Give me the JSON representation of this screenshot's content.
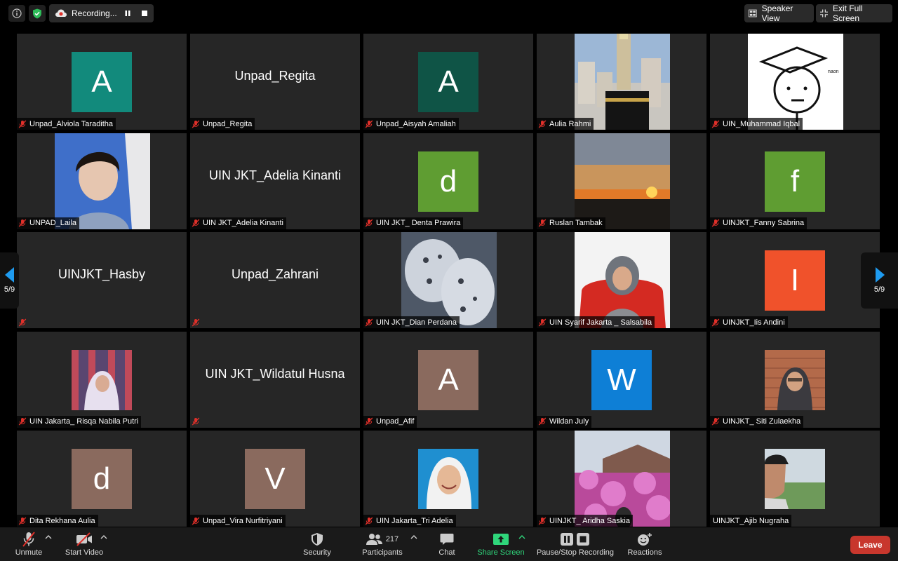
{
  "top_bar": {
    "recording_label": "Recording...",
    "speaker_view_label": "Speaker View",
    "exit_full_screen_label": "Exit Full Screen"
  },
  "page_indicator": "5/9",
  "tiles": [
    {
      "name": "Unpad_Alviola Taraditha",
      "type": "avatar",
      "letter": "A",
      "color": "#128a7c"
    },
    {
      "name": "Unpad_Regita",
      "type": "text",
      "display_name": "Unpad_Regita"
    },
    {
      "name": "Unpad_Aisyah Amaliah",
      "type": "avatar",
      "letter": "A",
      "color": "#0f5446"
    },
    {
      "name": "Aulia Rahmi",
      "type": "photo",
      "photo": "mecca-clock-tower"
    },
    {
      "name": "UIN_Muhammad Iqbal",
      "type": "photo",
      "photo": "drawing-face",
      "drawing_text": "naon"
    },
    {
      "name": "UNPAD_Laila",
      "type": "photo",
      "photo": "person-selfie"
    },
    {
      "name": "UIN JKT_Adelia Kinanti",
      "type": "text",
      "display_name": "UIN JKT_Adelia Kinanti"
    },
    {
      "name": "UIN JKT_ Denta Prawira",
      "type": "avatar",
      "letter": "d",
      "color": "#5f9d32"
    },
    {
      "name": "Ruslan Tambak",
      "type": "photo",
      "photo": "sunset-sea"
    },
    {
      "name": "UINJKT_Fanny Sabrina",
      "type": "avatar",
      "letter": "f",
      "color": "#5f9d32"
    },
    {
      "name": "",
      "type": "text",
      "display_name": "UINJKT_Hasby"
    },
    {
      "name": "",
      "type": "text",
      "display_name": "Unpad_Zahrani"
    },
    {
      "name": "UIN JKT_Dian Perdana",
      "type": "photo",
      "photo": "snow-leopards"
    },
    {
      "name": "UIN Syarif Jakarta _ Salsabila",
      "type": "photo",
      "photo": "woman-red-chair"
    },
    {
      "name": "UINJKT_Iis Andini",
      "type": "avatar",
      "letter": "I",
      "color": "#f0522b"
    },
    {
      "name": "UIN Jakarta_ Risqa Nabila Putri",
      "type": "photo",
      "photo": "woman-hijab-stripes"
    },
    {
      "name": "",
      "type": "text",
      "display_name": "UIN JKT_Wildatul Husna"
    },
    {
      "name": "Unpad_Afif",
      "type": "avatar",
      "letter": "A",
      "color": "#8a6a5e"
    },
    {
      "name": "Wildan July",
      "type": "avatar",
      "letter": "W",
      "color": "#0e7fd6"
    },
    {
      "name": "UINJKT_ Siti Zulaekha",
      "type": "photo",
      "photo": "woman-brick-wall"
    },
    {
      "name": "Dita Rekhana Aulia",
      "type": "avatar",
      "letter": "d",
      "color": "#8a6a5e"
    },
    {
      "name": "Unpad_Vira Nurfitriyani",
      "type": "avatar",
      "letter": "V",
      "color": "#8a6a5e"
    },
    {
      "name": "UIN Jakarta_Tri Adelia",
      "type": "photo",
      "photo": "girl-white-hijab"
    },
    {
      "name": "UINJKT_ Aridha Saskia",
      "type": "photo",
      "photo": "pink-flowers-house"
    },
    {
      "name": "UINJKT_Ajib Nugraha",
      "type": "photo",
      "photo": "man-cap-field",
      "mic": "none"
    }
  ],
  "toolbar": {
    "unmute_label": "Unmute",
    "start_video_label": "Start Video",
    "security_label": "Security",
    "participants_label": "Participants",
    "participants_count": "217",
    "chat_label": "Chat",
    "share_screen_label": "Share Screen",
    "pause_stop_label": "Pause/Stop Recording",
    "reactions_label": "Reactions",
    "leave_label": "Leave"
  },
  "colors": {
    "share_green": "#2fd67b",
    "leave_red": "#c8372d",
    "nav_arrow_blue": "#1e9bf0",
    "muted_red": "#e0302a"
  }
}
